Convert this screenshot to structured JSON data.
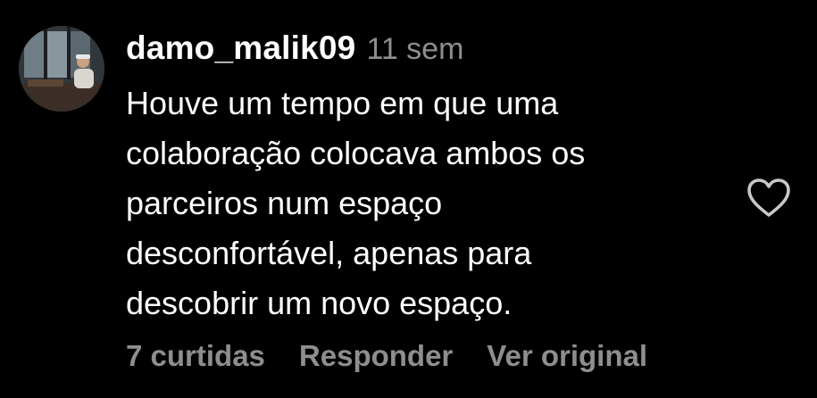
{
  "comment": {
    "username": "damo_malik09",
    "time": "11 sem",
    "text_lines": [
      "Houve um tempo em que uma",
      "colaboração colocava ambos os",
      "parceiros num espaço",
      "desconfortável, apenas para",
      "descobrir um novo espaço."
    ],
    "actions": {
      "likes": "7 curtidas",
      "reply": "Responder",
      "see_original": "Ver original"
    },
    "like_icon": "heart-outline-icon"
  },
  "colors": {
    "background": "#000000",
    "primary_text": "#ffffff",
    "secondary_text": "#8e8e8e"
  }
}
